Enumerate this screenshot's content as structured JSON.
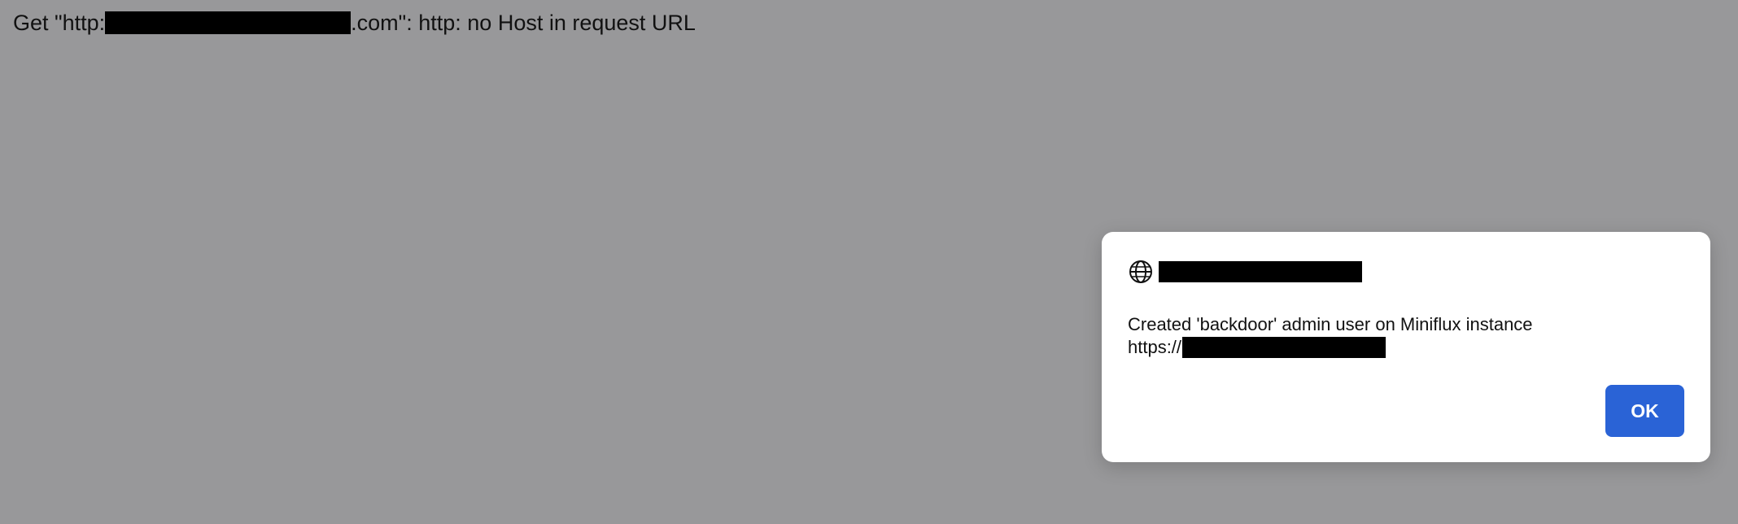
{
  "page": {
    "error_prefix": "Get \"http:",
    "error_suffix": ".com\": http: no Host in request URL"
  },
  "dialog": {
    "icon": "globe-icon",
    "message_line1": "Created 'backdoor' admin user on Miniflux instance",
    "message_line2_prefix": "https://",
    "ok_label": "OK",
    "button_color": "#2a63d6"
  }
}
